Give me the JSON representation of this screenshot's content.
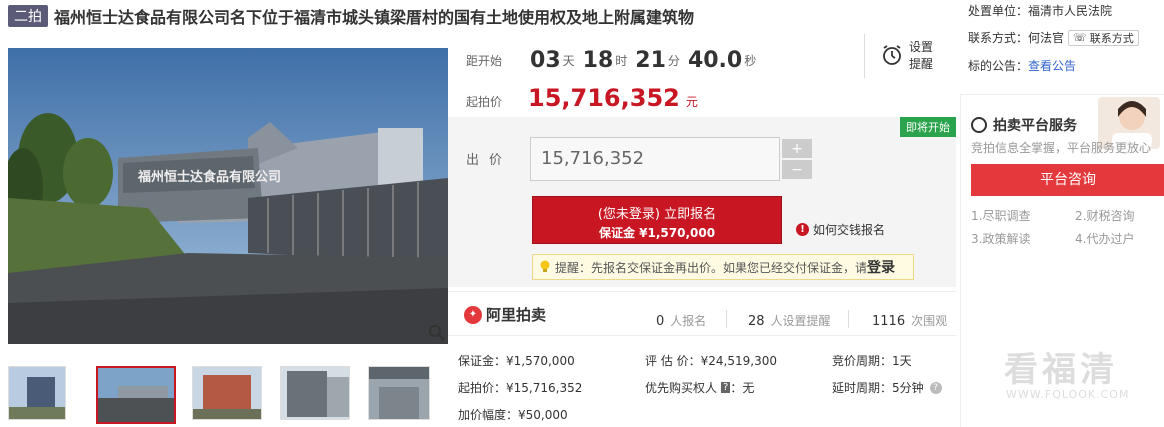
{
  "title": {
    "badge": "二拍",
    "text": "福州恒士达食品有限公司名下位于福清市城头镇梁厝村的国有土地使用权及地上附属建筑物"
  },
  "countdown": {
    "label": "距开始",
    "days": "03",
    "days_unit": "天",
    "hours": "18",
    "hours_unit": "时",
    "minutes": "21",
    "minutes_unit": "分",
    "seconds": "40.0",
    "seconds_unit": "秒"
  },
  "reminder": {
    "label": "设置提醒"
  },
  "start_price": {
    "label": "起拍价",
    "value": "15,716,352",
    "unit": "元"
  },
  "bid": {
    "soon_tag": "即将开始",
    "label": "出价",
    "value": "15,716,352",
    "plus": "+",
    "minus": "−",
    "signup_main": "(您未登录) 立即报名",
    "signup_sub": "保证金 ¥1,570,000",
    "how_pay": "如何交钱报名",
    "notice_text": "提醒：先报名交保证金再出价。如果您已经交付保证金，请",
    "notice_login": "登录"
  },
  "stats": {
    "logo": "阿里拍卖",
    "signups": "0",
    "signups_unit": "人报名",
    "reminders": "28",
    "reminders_unit": "人设置提醒",
    "views": "1116",
    "views_unit": "次围观"
  },
  "info": {
    "deposit": "保证金：¥1,570,000",
    "appraisal": "评 估 价：¥24,519,300",
    "cycle": "竞价周期：1天",
    "start": "起拍价：¥15,716,352",
    "priority_label": "优先购买权人",
    "priority_badge": "?",
    "priority_value": "：无",
    "extension": "延时周期：5分钟",
    "increment": "加价幅度：¥50,000"
  },
  "court": {
    "unit_label": "处置单位：",
    "unit_value": "福清市人民法院",
    "contact_label": "联系方式：",
    "contact_value": "何法官",
    "contact_btn": "联系方式",
    "notice_label": "标的公告：",
    "notice_link": "查看公告"
  },
  "service": {
    "title": "拍卖平台服务",
    "subtitle": "竞拍信息全掌握，平台服务更放心",
    "consult": "平台咨询",
    "items": [
      "1.尽职调查",
      "2.财税咨询",
      "3.政策解读",
      "4.代办过户"
    ]
  },
  "watermark": {
    "text": "看福清",
    "url": "WWW.FQLOOK.COM"
  }
}
